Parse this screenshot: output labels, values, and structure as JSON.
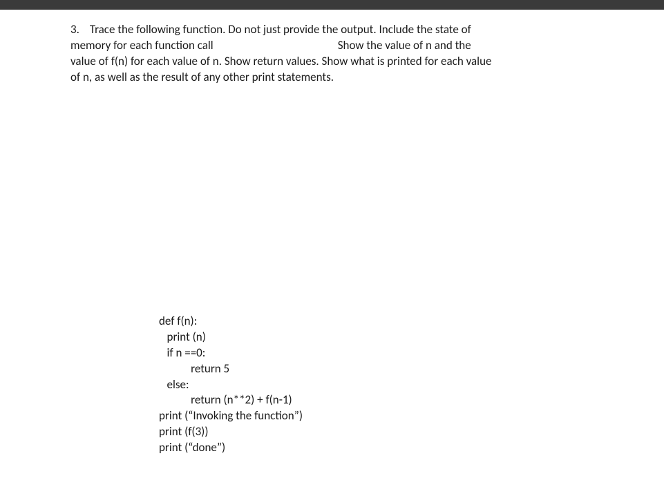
{
  "question": {
    "number": "3.",
    "line1_part1": "Trace the following function.  Do not just provide the output.  Include the state of",
    "line2_part1": "memory for each function call",
    "line2_part2": "Show the value of n and the",
    "line3": "value of f(n) for each value of n.  Show return values.  Show what is printed for each value",
    "line4": "of n, as well as the result of any other print statements."
  },
  "code": {
    "l1": "def f(n):",
    "l2": "   print (n)",
    "l3": "   if n ==0:",
    "l4": "            return 5",
    "l5": "   else:",
    "l6": "            return (n**2) + f(n-1)",
    "l7": "print (“Invoking the function”)",
    "l8": "print (f(3))",
    "l9": "print (“done”)"
  }
}
